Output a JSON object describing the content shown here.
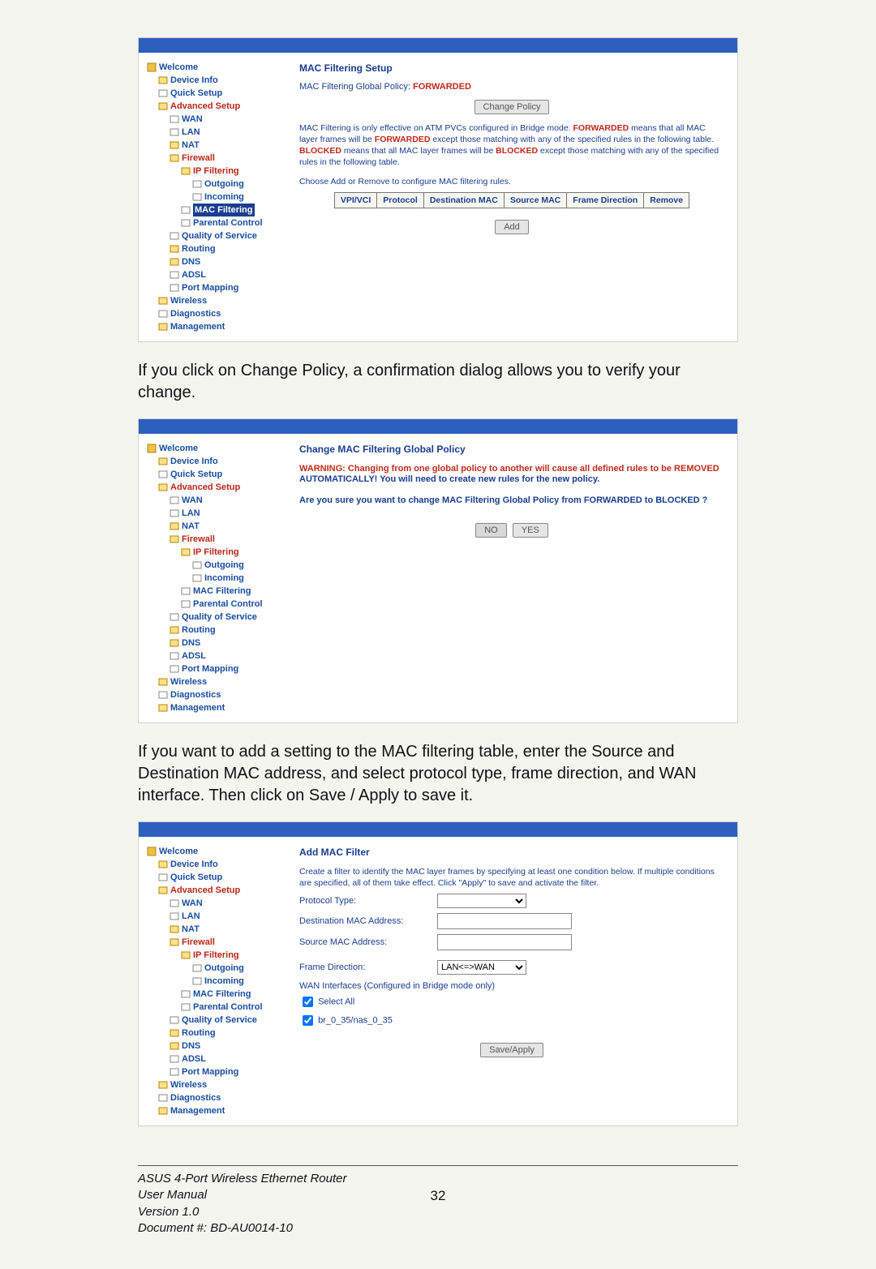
{
  "tree": {
    "welcome": "Welcome",
    "device_info": "Device Info",
    "quick_setup": "Quick Setup",
    "advanced_setup": "Advanced Setup",
    "wan": "WAN",
    "lan": "LAN",
    "nat": "NAT",
    "firewall": "Firewall",
    "ip_filtering": "IP Filtering",
    "outgoing": "Outgoing",
    "incoming": "Incoming",
    "mac_filtering": "MAC Filtering",
    "parental_control": "Parental Control",
    "qos": "Quality of Service",
    "routing": "Routing",
    "dns": "DNS",
    "adsl": "ADSL",
    "port_mapping": "Port Mapping",
    "wireless": "Wireless",
    "diagnostics": "Diagnostics",
    "management": "Management"
  },
  "shot1": {
    "title": "MAC Filtering Setup",
    "policy_line_1": "MAC Filtering Global Policy: ",
    "policy_value": "FORWARDED",
    "change_policy_btn": "Change Policy",
    "explain_1": "MAC Filtering is only effective on ATM PVCs configured in Bridge mode. ",
    "explain_fw1": "FORWARDED",
    "explain_2": " means that all MAC layer frames will be ",
    "explain_fw2": "FORWARDED",
    "explain_3": " except those matching with any of the specified rules in the following table. ",
    "explain_bl1": "BLOCKED",
    "explain_4": " means that all MAC layer frames will be ",
    "explain_bl2": "BLOCKED",
    "explain_5": " except those matching with any of the specified rules in the following table.",
    "choose": "Choose Add or Remove to configure MAC filtering rules.",
    "th_vpi": "VPI/VCI",
    "th_proto": "Protocol",
    "th_dest": "Destination MAC",
    "th_src": "Source MAC",
    "th_dir": "Frame Direction",
    "th_rem": "Remove",
    "add_btn": "Add"
  },
  "para1": "If you click on Change Policy, a confirmation dialog allows you to verify your change.",
  "para1_bold": "Change Policy",
  "para1_pre": "If you click on ",
  "para1_post": ", a confirmation dialog allows you to verify your change.",
  "shot2": {
    "title": "Change MAC Filtering Global Policy",
    "warn": "WARNING: Changing from one global policy to another will cause all defined rules to be REMOVED",
    "auto": "AUTOMATICALLY! You will need to create new rules for the new policy.",
    "question": "Are you sure you want to change MAC Filtering Global Policy from FORWARDED to BLOCKED ?",
    "no_btn": "NO",
    "yes_btn": "YES"
  },
  "para2_pre": "If you want to add a setting to the MAC filtering table, enter the Source and Destination MAC address, and select protocol type, frame direction, and WAN interface. Then click on ",
  "para2_bold": "Save / Apply",
  "para2_post": " to save it.",
  "shot3": {
    "title": "Add MAC Filter",
    "intro": "Create a filter to identify the MAC layer frames by specifying at least one condition below. If multiple conditions are specified, all of them take effect. Click \"Apply\" to save and activate the filter.",
    "protocol_type": "Protocol Type:",
    "dest_mac": "Destination MAC Address:",
    "src_mac": "Source MAC Address:",
    "frame_dir": "Frame Direction:",
    "frame_dir_value": "LAN<=>WAN",
    "wan_if": "WAN Interfaces (Configured in Bridge mode only)",
    "select_all": "Select All",
    "iface": "br_0_35/nas_0_35",
    "save_btn": "Save/Apply"
  },
  "footer": {
    "l1": "ASUS 4-Port Wireless Ethernet Router",
    "l2": "User Manual",
    "l3": "Version 1.0",
    "l4": "Document #:  BD-AU0014-10",
    "page": "32"
  }
}
